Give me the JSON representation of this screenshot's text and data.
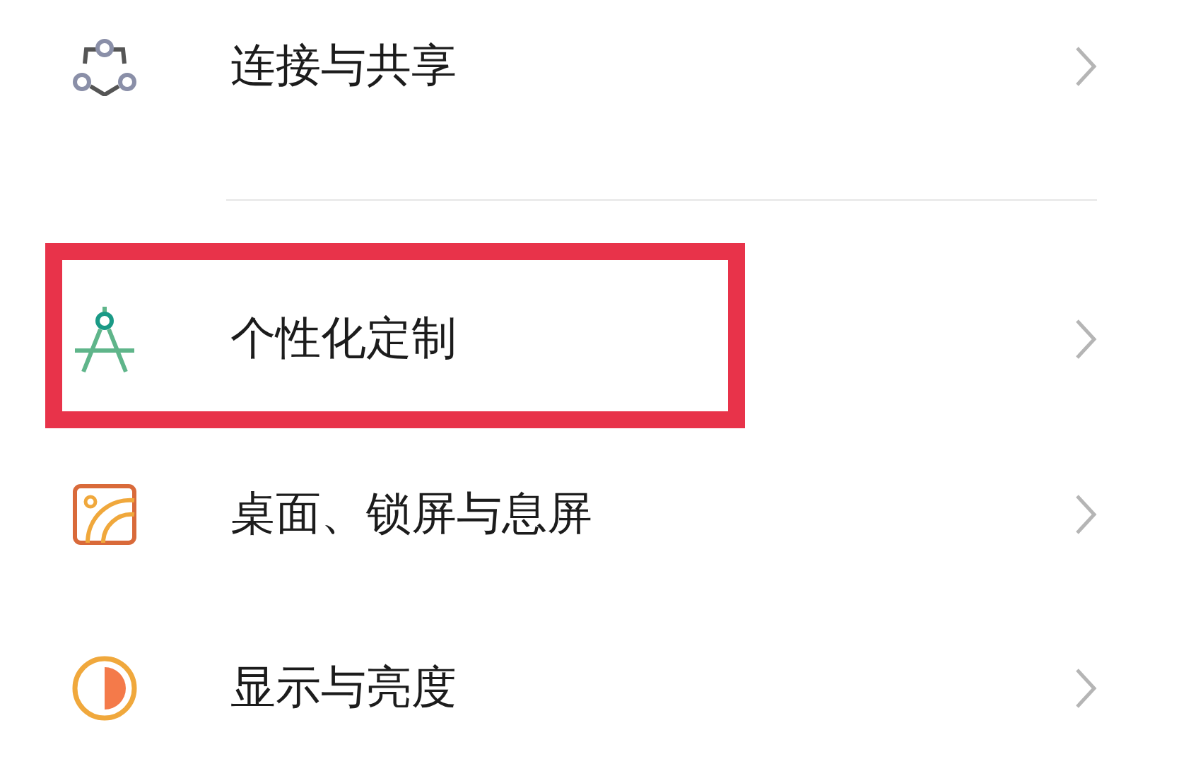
{
  "settings_items": [
    {
      "kind": "share",
      "label": "连接与共享",
      "highlighted": false,
      "divider_after": true
    },
    {
      "kind": "compass",
      "label": "个性化定制",
      "highlighted": true,
      "divider_after": false
    },
    {
      "kind": "wallpaper",
      "label": "桌面、锁屏与息屏",
      "highlighted": false,
      "divider_after": false
    },
    {
      "kind": "display",
      "label": "显示与亮度",
      "highlighted": false,
      "divider_after": false
    }
  ]
}
